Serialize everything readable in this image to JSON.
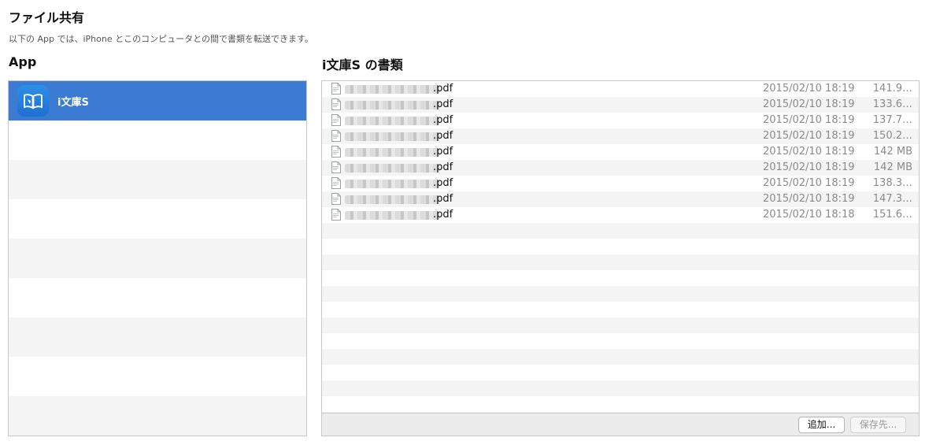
{
  "page": {
    "title": "ファイル共有",
    "subtitle": "以下の App では、iPhone とこのコンピュータとの間で書類を転送できます。"
  },
  "apps_panel": {
    "heading": "App",
    "items": [
      {
        "name": "i文庫S",
        "selected": true,
        "icon": "book-app-icon"
      }
    ]
  },
  "documents_panel": {
    "heading": "i文庫S の書類",
    "files": [
      {
        "ext": ".pdf",
        "date": "2015/02/10 18:19",
        "size": "141.9…"
      },
      {
        "ext": ".pdf",
        "date": "2015/02/10 18:19",
        "size": "133.6…"
      },
      {
        "ext": ".pdf",
        "date": "2015/02/10 18:19",
        "size": "137.7…"
      },
      {
        "ext": ".pdf",
        "date": "2015/02/10 18:19",
        "size": "150.2…"
      },
      {
        "ext": ".pdf",
        "date": "2015/02/10 18:19",
        "size": "142 MB"
      },
      {
        "ext": ".pdf",
        "date": "2015/02/10 18:19",
        "size": "142 MB"
      },
      {
        "ext": ".pdf",
        "date": "2015/02/10 18:19",
        "size": "138.3…"
      },
      {
        "ext": ".pdf",
        "date": "2015/02/10 18:19",
        "size": "147.3…"
      },
      {
        "ext": ".pdf",
        "date": "2015/02/10 18:18",
        "size": "151.6…"
      }
    ],
    "add_button": "追加...",
    "save_button": "保存先..."
  },
  "colors": {
    "selection": "#3b7bd3",
    "row_alt": "#f4f4f4",
    "meta_text": "#8a8a8a"
  }
}
